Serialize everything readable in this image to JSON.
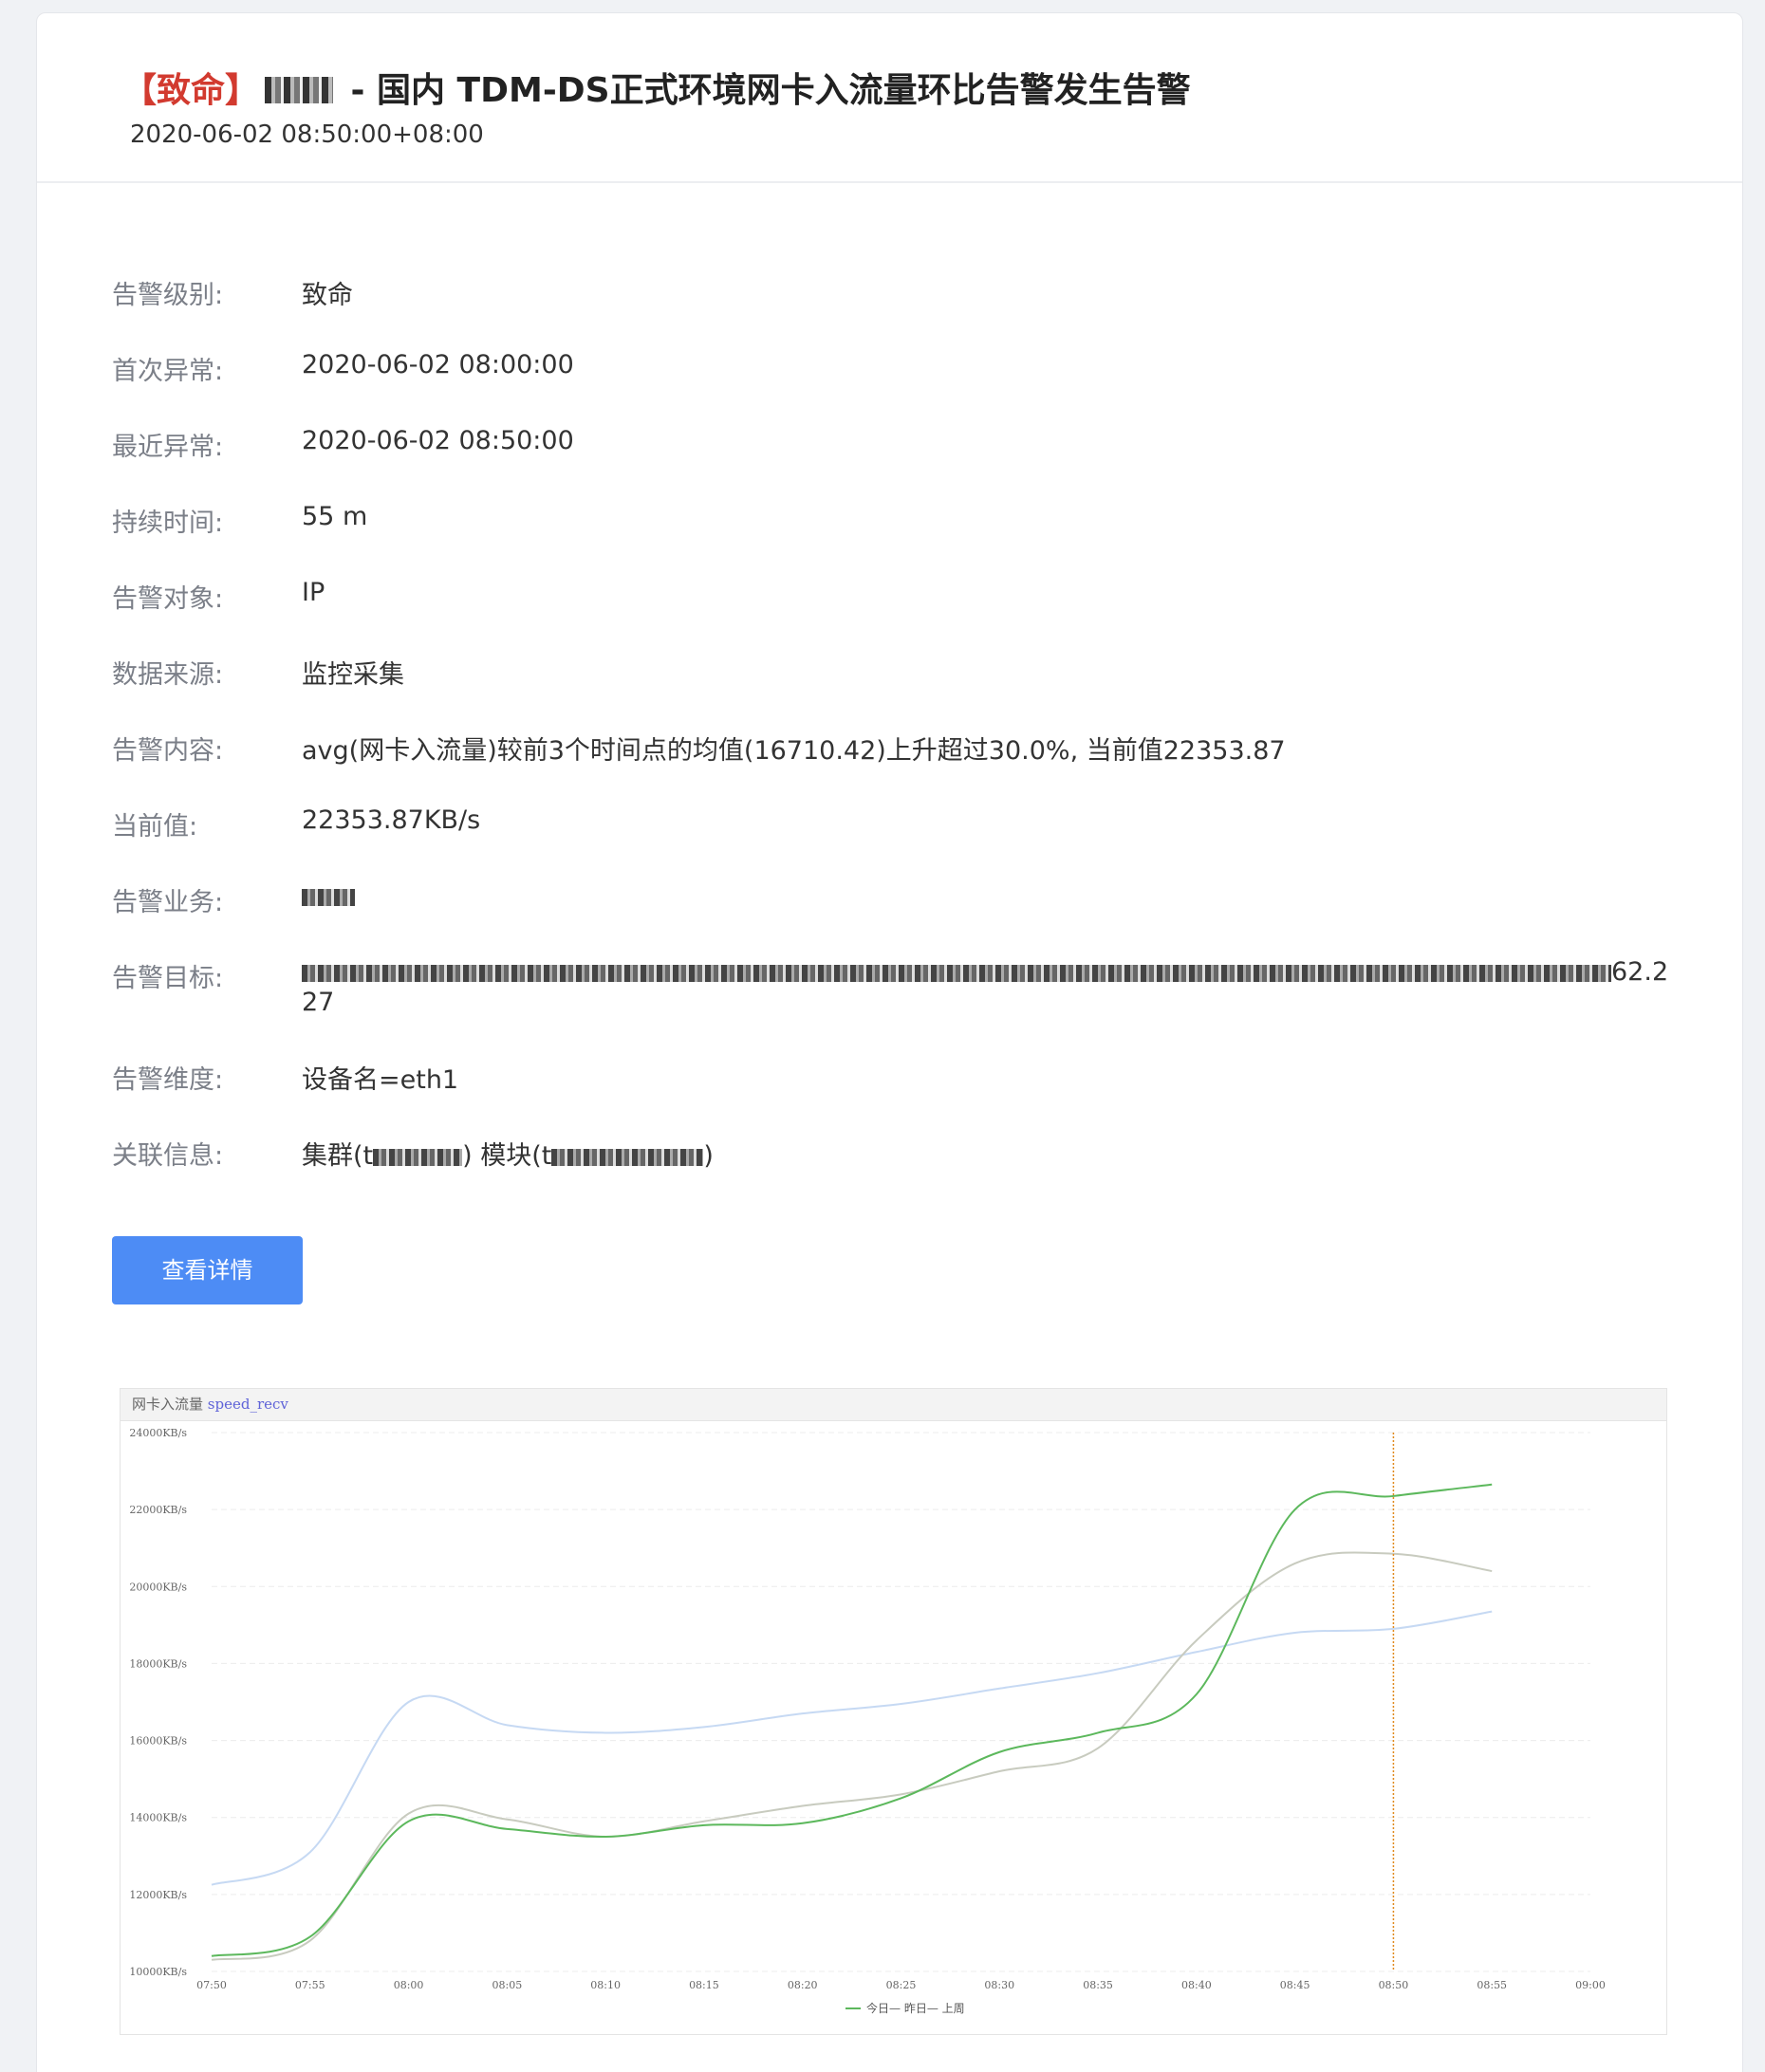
{
  "header": {
    "level": "【致命】",
    "title_rest": " - 国内 TDM-DS正式环境网卡入流量环比告警发生告警",
    "timestamp": "2020-06-02 08:50:00+08:00"
  },
  "details": {
    "level": {
      "label": "告警级别:",
      "value": "致命"
    },
    "first": {
      "label": "首次异常:",
      "value": "2020-06-02 08:00:00"
    },
    "last": {
      "label": "最近异常:",
      "value": "2020-06-02 08:50:00"
    },
    "duration": {
      "label": "持续时间:",
      "value": "55 m"
    },
    "object": {
      "label": "告警对象:",
      "value": "IP"
    },
    "source": {
      "label": "数据来源:",
      "value": "监控采集"
    },
    "content": {
      "label": "告警内容:",
      "value": "avg(网卡入流量)较前3个时间点的均值(16710.42)上升超过30.0%, 当前值22353.87"
    },
    "current": {
      "label": "当前值:",
      "value": "22353.87KB/s"
    },
    "business": {
      "label": "告警业务:"
    },
    "target": {
      "label": "告警目标:",
      "visible_tail": "62.2",
      "line2": "27"
    },
    "dimension": {
      "label": "告警维度:",
      "value": "设备名=eth1"
    },
    "related": {
      "label": "关联信息:",
      "cluster_prefix": "集群(t",
      "module_prefix": ") 模块(t",
      "suffix": ")"
    }
  },
  "button": {
    "label": "查看详情"
  },
  "chart_data": {
    "type": "line",
    "header_label": "网卡入流量",
    "header_metric": "speed_recv",
    "x": [
      "07:50",
      "07:55",
      "08:00",
      "08:05",
      "08:10",
      "08:15",
      "08:20",
      "08:25",
      "08:30",
      "08:35",
      "08:40",
      "08:45",
      "08:50",
      "08:55"
    ],
    "x_ticks": [
      "07:50",
      "07:55",
      "08:00",
      "08:05",
      "08:10",
      "08:15",
      "08:20",
      "08:25",
      "08:30",
      "08:35",
      "08:40",
      "08:45",
      "08:50",
      "08:55",
      "09:00"
    ],
    "y_ticks": [
      "10000KB/s",
      "12000KB/s",
      "14000KB/s",
      "16000KB/s",
      "18000KB/s",
      "20000KB/s",
      "22000KB/s",
      "24000KB/s"
    ],
    "ylim": [
      10000,
      24000
    ],
    "marker_x": "08:50",
    "legend_text": "今日— 昨日— 上周",
    "series": [
      {
        "name": "今日",
        "color": "#5cb85c",
        "values": [
          10400,
          10900,
          13900,
          13700,
          13500,
          13800,
          13850,
          14500,
          15700,
          16200,
          17200,
          22000,
          22350,
          22650
        ]
      },
      {
        "name": "昨日",
        "color": "#c8cbbf",
        "values": [
          10300,
          10800,
          14100,
          13950,
          13500,
          13900,
          14300,
          14600,
          15200,
          15800,
          18600,
          20600,
          20850,
          20400
        ]
      },
      {
        "name": "上周",
        "color": "#c6d9f3",
        "values": [
          12250,
          13100,
          17000,
          16400,
          16200,
          16350,
          16700,
          16950,
          17350,
          17750,
          18300,
          18800,
          18900,
          19350
        ]
      }
    ],
    "grid": true
  }
}
